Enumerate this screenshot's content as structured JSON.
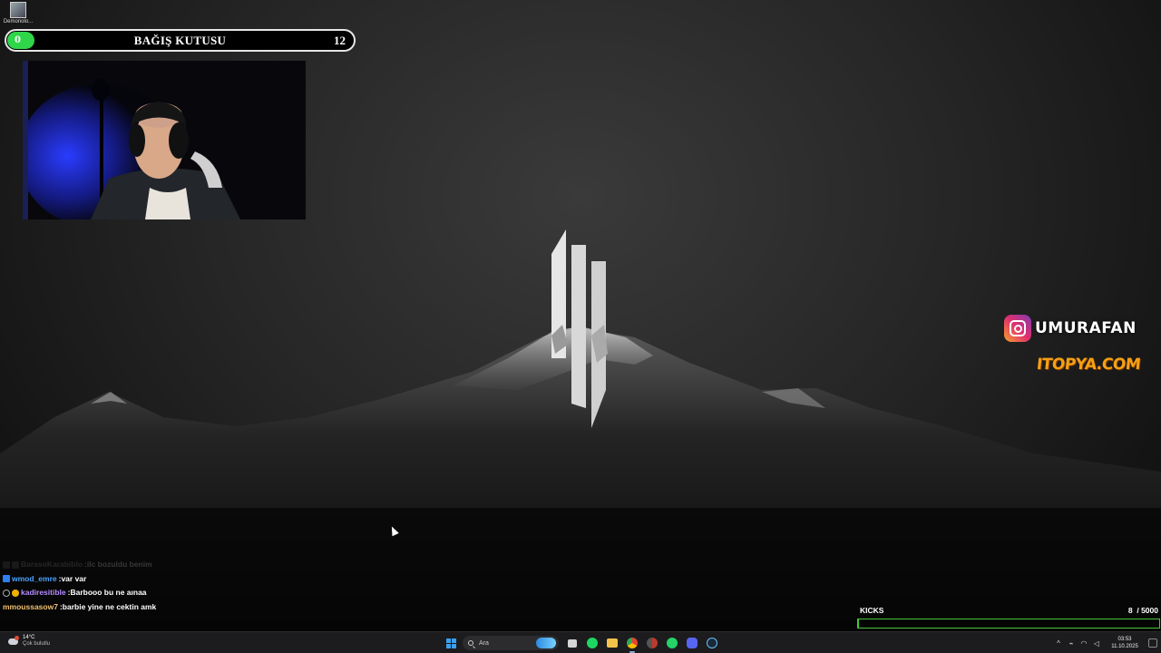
{
  "desktop": {
    "icon_label": "Demonolo..."
  },
  "donation_box": {
    "title": "BAĞIŞ KUTUSU",
    "count": "12",
    "pill_text": "0",
    "pill_color": "#2fd64a"
  },
  "social": {
    "instagram_handle": "UMURAFAN",
    "site": "ITOPYA.COM"
  },
  "chat": {
    "messages": [
      {
        "user": "BarasoKarabiblo",
        "text": "ilc bozuldu benim",
        "user_color": "#aaaaaa",
        "faded": true
      },
      {
        "user": "wmod_emre",
        "text": "var var",
        "user_color": "#4aa3ff",
        "faded": false
      },
      {
        "user": "kadiresitible",
        "text": "Barbooo bu ne aınaa",
        "user_color": "#b58cff",
        "faded": false
      },
      {
        "user": "mmoussasow7",
        "text": "barbie yine ne cektin amk",
        "user_color": "#f0c070",
        "faded": false
      }
    ]
  },
  "kicks": {
    "label": "KICKS",
    "current": "8",
    "separator": "/",
    "goal": "5000",
    "progress_fraction": 0.0016,
    "bar_color": "#49c43c"
  },
  "taskbar": {
    "weather_temp": "14°C",
    "weather_condition": "Çok bulutlu",
    "search_placeholder": "Ara",
    "apps": [
      "windows-start",
      "search",
      "task-view",
      "spotify",
      "file-explorer",
      "chrome",
      "chrome-alt",
      "whatsapp",
      "discord",
      "steam"
    ],
    "clock_time": "03:53",
    "clock_date": "11.10.2025",
    "tray_icons": [
      "chevron-up-icon",
      "network-icon",
      "wifi-icon",
      "speaker-icon"
    ]
  },
  "colors": {
    "accent_green": "#49c43c",
    "instagram_gradient_start": "#f9a12e",
    "site_orange": "#f6a015"
  }
}
